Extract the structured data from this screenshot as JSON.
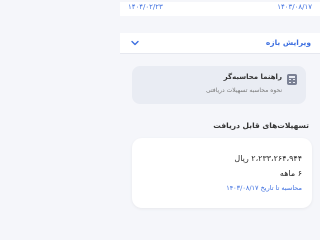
{
  "dates": {
    "start": "۱۴۰۳/۰۸/۱۷",
    "end": "۱۴۰۴/۰۲/۲۳"
  },
  "edit": {
    "label": "ویرایش بازه",
    "icon": "chevron-down-icon"
  },
  "guide": {
    "title": "راهنما محاسبه‌گر",
    "subtitle": "نحوه محاسبه تسهیلات دریافتی",
    "icon": "calculator-icon"
  },
  "section": {
    "title": "تسهیلات‌های قابل دریافت"
  },
  "facility": {
    "amount": "۲،۲۳۳،۲۶۴،۹۴۴ ریال",
    "term": "۶ ماهه",
    "calc_note": "محاسبه تا تاریخ ۱۴۰۳/۰۸/۱۷"
  },
  "colors": {
    "accent": "#3d6fe0",
    "card_bg": "#e9ecf3",
    "page_bg": "#f5f6fa"
  }
}
